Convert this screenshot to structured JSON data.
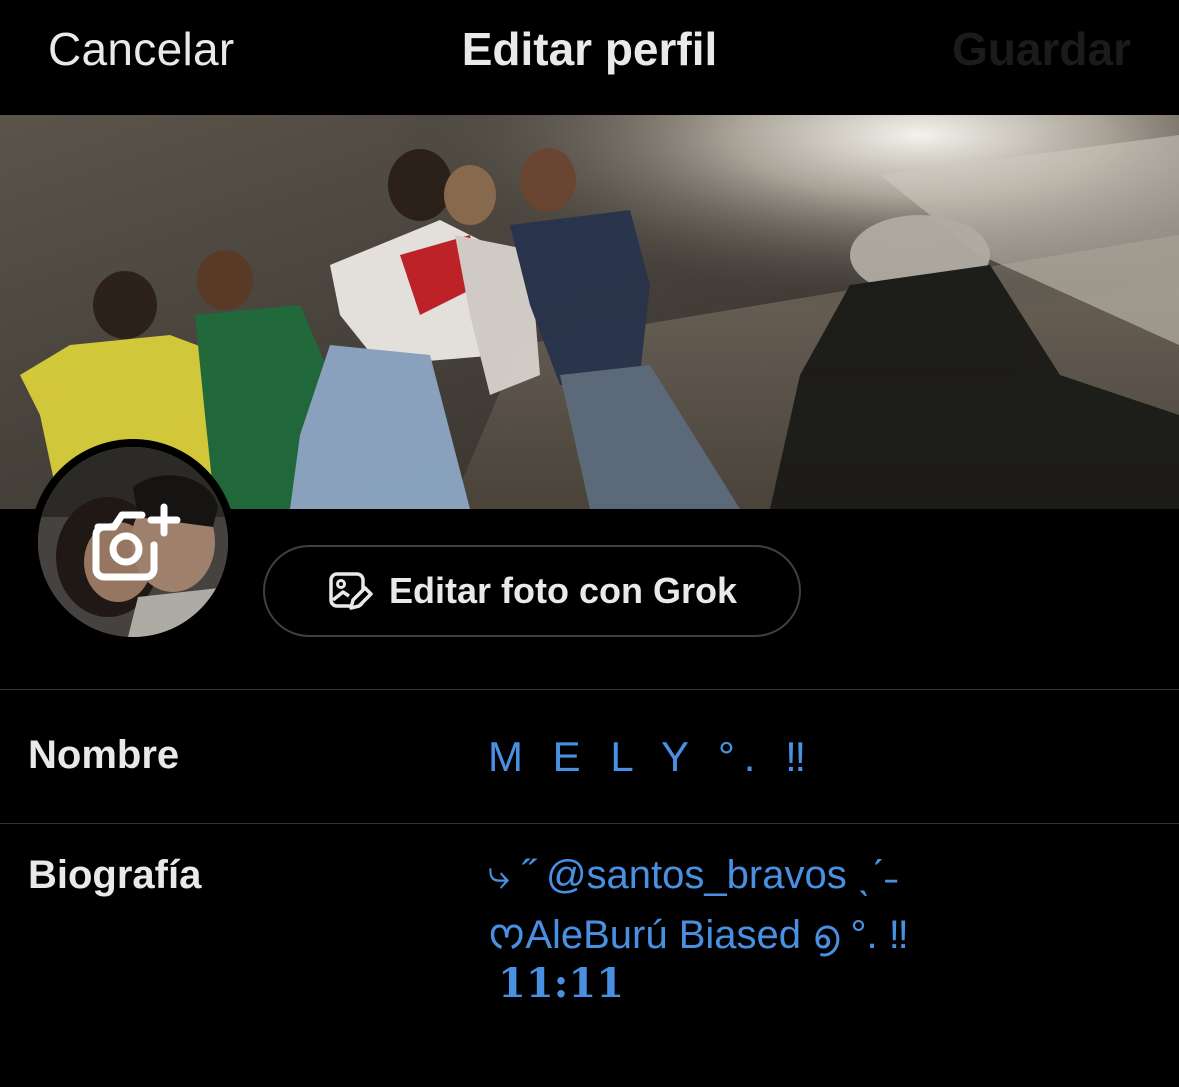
{
  "header": {
    "cancel_label": "Cancelar",
    "title": "Editar perfil",
    "save_label": "Guardar"
  },
  "banner": {
    "alt": "header photo"
  },
  "avatar": {
    "camera_icon": "camera-plus-icon"
  },
  "grok_button": {
    "icon": "image-edit-icon",
    "label": "Editar foto con Grok"
  },
  "fields": {
    "name": {
      "label": "Nombre",
      "value": "M E L Y °. ‼"
    },
    "bio": {
      "label": "Biografía",
      "line1": "⤷ ˝   @santos_bravos ˎˊ˗",
      "line2": "ᰔAleBurú Biased ൭ °. ‼",
      "line3": "11:11"
    }
  },
  "colors": {
    "background": "#000000",
    "text": "#e7e9ea",
    "link": "#4a90e2",
    "divider": "#2f3336",
    "save_disabled": "#1b1b1b"
  }
}
